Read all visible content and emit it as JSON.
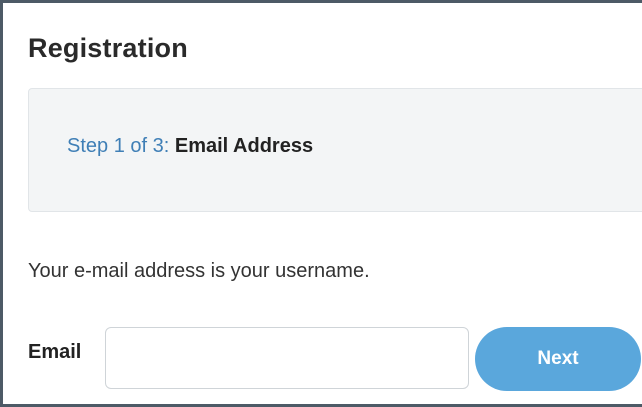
{
  "form": {
    "title": "Registration",
    "step": {
      "prefix": "Step 1 of 3:",
      "name": "Email Address"
    },
    "instruction": "Your e-mail address is your username.",
    "email_field": {
      "label": "Email",
      "value": "",
      "placeholder": ""
    },
    "next_button": {
      "label": "Next"
    }
  },
  "colors": {
    "frame_border": "#4d5a66",
    "step_accent": "#3f7fb6",
    "step_box_background": "#f3f5f6",
    "button_background": "#5aa7dc",
    "button_text": "#ffffff"
  }
}
